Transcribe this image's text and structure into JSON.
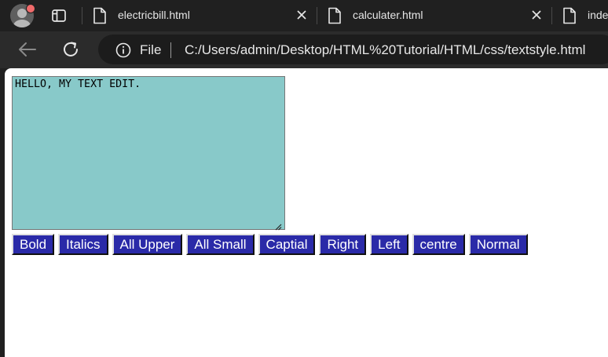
{
  "tabs": [
    {
      "title": "electricbill.html"
    },
    {
      "title": "calculater.html"
    },
    {
      "title": "inde"
    }
  ],
  "address_bar": {
    "scheme_label": "File",
    "url": "C:/Users/admin/Desktop/HTML%20Tutorial/HTML/css/textstyle.html"
  },
  "editor": {
    "value": "HELLO, MY TEXT EDIT."
  },
  "buttons": {
    "bold": "Bold",
    "italics": "Italics",
    "all_upper": "All Upper",
    "all_small": "All Small",
    "capital": "Captial",
    "right": "Right",
    "left": "Left",
    "centre": "centre",
    "normal": "Normal"
  },
  "colors": {
    "editor_bg": "#88c9c9",
    "button_bg": "#2a2aa8",
    "button_text": "#ffffff",
    "browser_chrome": "#202020"
  },
  "icons": {
    "profile": "avatar-icon",
    "tab_actions": "tab-actions-icon",
    "file": "file-icon",
    "close": "close-icon",
    "back": "back-arrow-icon",
    "reload": "reload-icon",
    "info": "info-icon"
  }
}
